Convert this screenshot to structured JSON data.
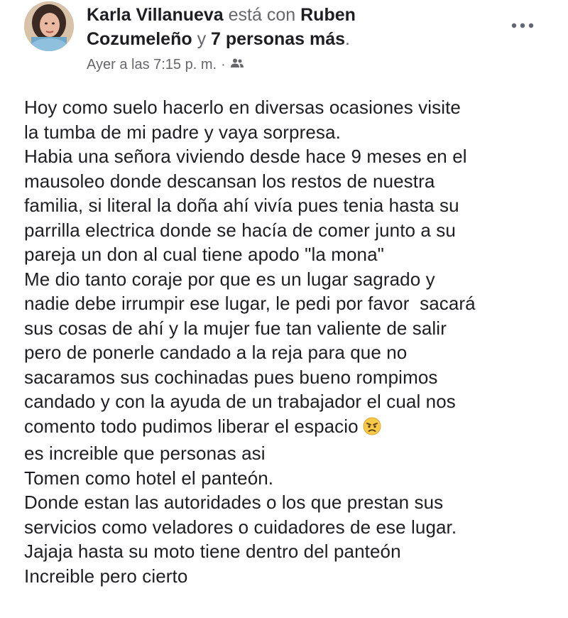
{
  "post": {
    "author": "Karla Villanueva",
    "with_text": "está con",
    "tagged_person": "Ruben",
    "tagged_person_cont": "Cozumeleño",
    "and_text": "y",
    "others": "7 personas más",
    "period": ".",
    "timestamp": "Ayer a las 7:15 p. m.",
    "separator": "·",
    "audience_icon": "friends-icon",
    "more_icon": "more-options-icon",
    "lines": [
      "Hoy como suelo hacerlo en diversas ocasiones visite",
      "la tumba de mi padre y vaya sorpresa.",
      "Habia una señora viviendo desde hace 9 meses en el",
      "mausoleo donde descansan los restos de nuestra",
      "familia, si literal la doña ahí vivía pues tenia hasta su",
      "parrilla electrica donde se hacía de comer junto a su",
      "pareja un don al cual tiene apodo \"la mona\"",
      "Me dio tanto coraje por que es un lugar sagrado y",
      "nadie debe irrumpir ese lugar, le pedi por favor  sacará",
      "sus cosas de ahí y la mujer fue tan valiente de salir",
      "pero de ponerle candado a la reja para que no",
      "sacaramos sus cochinadas pues bueno rompimos",
      "candado y con la ayuda de un trabajador el cual nos",
      "comento todo pudimos liberar el espacio",
      "es increible que personas asi",
      "Tomen como hotel el panteón.",
      "Donde estan las autoridades o los que prestan sus",
      "servicios como veladores o cuidadores de ese lugar.",
      "Jajaja hasta su moto tiene dentro del panteón",
      "Increible pero cierto"
    ],
    "emoji_icon": "angry-face-emoji-icon"
  }
}
